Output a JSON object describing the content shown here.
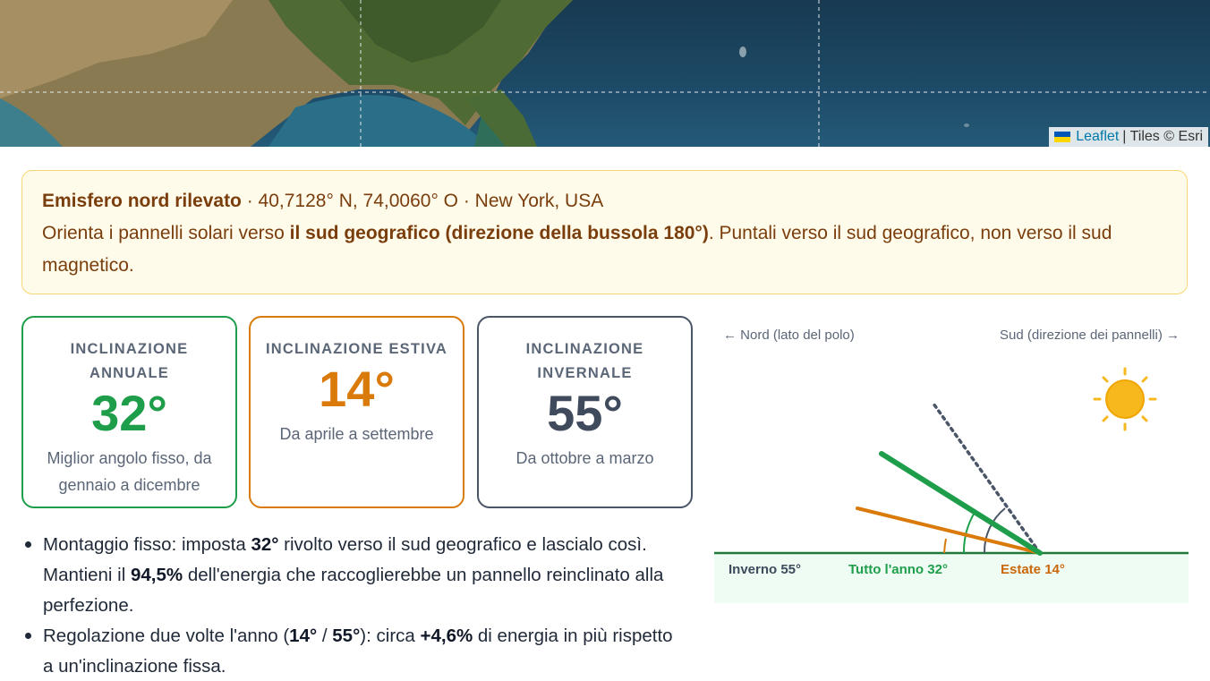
{
  "map": {
    "attribution_leaflet": "Leaflet",
    "attribution_tiles": "| Tiles © Esri"
  },
  "notice": {
    "hemisphere": "Emisfero nord rilevato",
    "location": " · 40,7128° N, 74,0060° O · New York, USA",
    "orient_prefix": "Orienta i pannelli solari verso ",
    "orient_bold": "il sud geografico (direzione della bussola 180°)",
    "orient_suffix": ". Puntali verso il sud geografico, non verso il sud magnetico."
  },
  "cards": {
    "annual": {
      "label": "INCLINAZIONE ANNUALE",
      "value": "32°",
      "desc": "Miglior angolo fisso, da gennaio a dicembre",
      "color": "#1e9e4a"
    },
    "summer": {
      "label": "INCLINAZIONE ESTIVA",
      "value": "14°",
      "desc": "Da aprile a settembre",
      "color": "#d97a0a"
    },
    "winter": {
      "label": "INCLINAZIONE INVERNALE",
      "value": "55°",
      "desc": "Da ottobre a marzo",
      "color": "#3f4a5c"
    }
  },
  "tips": {
    "fixed": {
      "t1": "Montaggio fisso: imposta ",
      "b1": "32°",
      "t2": " rivolto verso il sud geografico e lascialo così. Mantieni il ",
      "b2": "94,5%",
      "t3": " dell'energia che raccoglierebbe un pannello reinclinato alla perfezione."
    },
    "twice": {
      "t1": "Regolazione due volte l'anno (",
      "b1": "14°",
      "t2": " / ",
      "b2": "55°",
      "t3": "): circa ",
      "b3": "+4,6%",
      "t4": " di energia in più rispetto a un'inclinazione fissa."
    }
  },
  "diagram": {
    "north_label": "← Nord (lato del polo)",
    "south_label": "Sud (direzione dei pannelli) →",
    "winter_label": "Inverno 55°",
    "annual_label": "Tutto l'anno 32°",
    "summer_label": "Estate 14°",
    "sun_icon": "sun-icon",
    "colors": {
      "annual": "#1e9e4a",
      "summer": "#d97a0a",
      "winter": "#4a5568",
      "ground": "#1f7a3a",
      "sun": "#f6b81c"
    }
  }
}
